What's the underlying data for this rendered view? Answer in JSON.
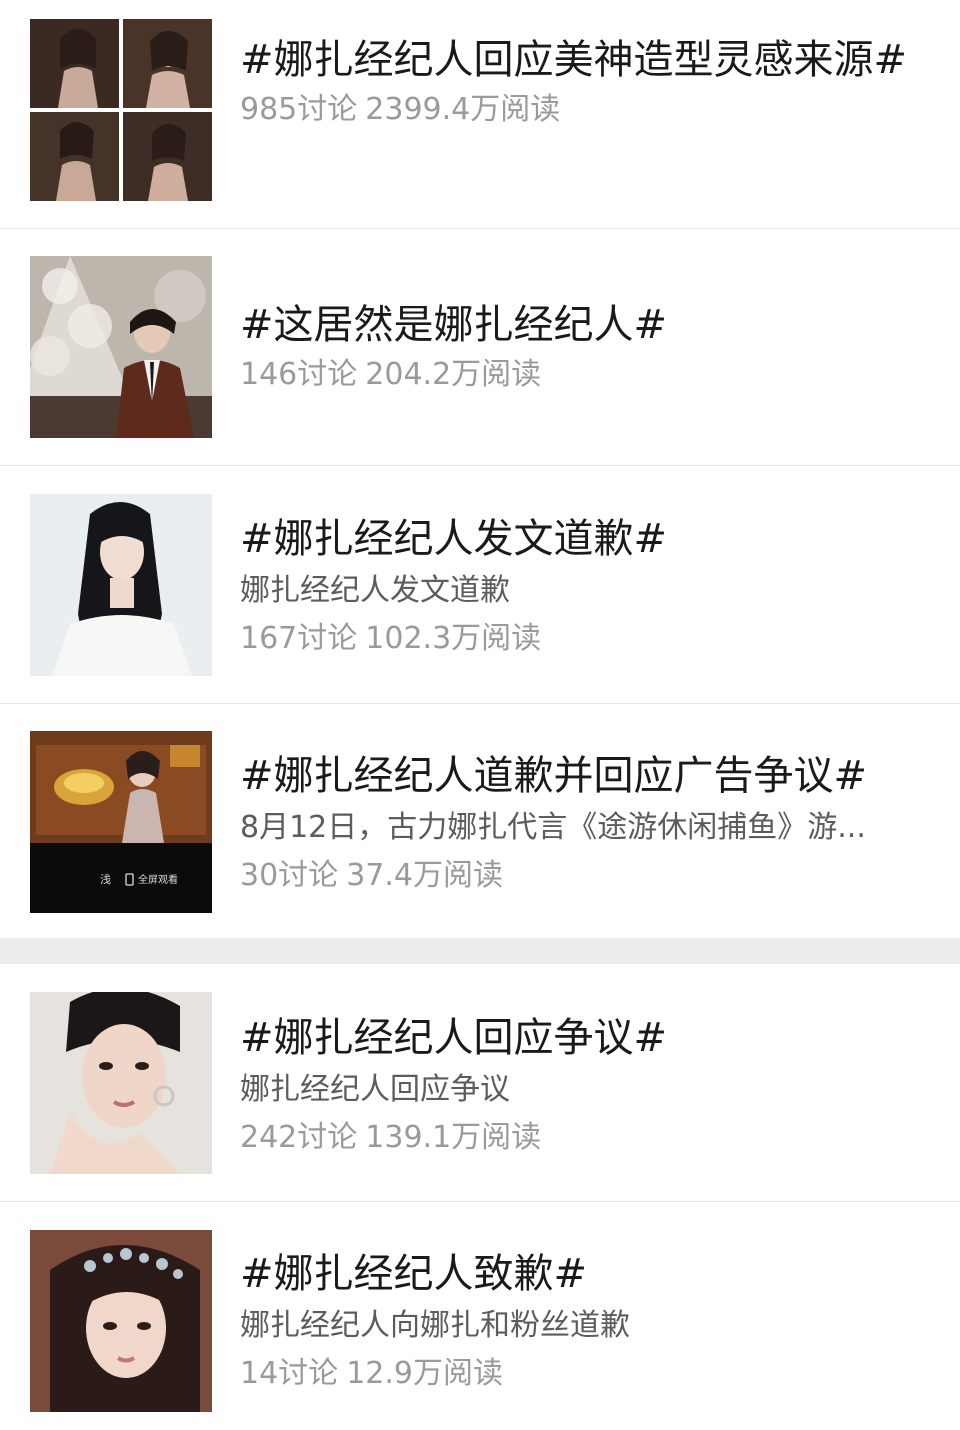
{
  "topics": [
    {
      "title": "#娜扎经纪人回应美神造型灵感来源#",
      "desc": "",
      "discussions": "985讨论",
      "reads": "2399.4万阅读",
      "thumb": "four-photo-grid-gown"
    },
    {
      "title": "#这居然是娜扎经纪人#",
      "desc": "",
      "discussions": "146讨论",
      "reads": "204.2万阅读",
      "thumb": "man-christmas-tree"
    },
    {
      "title": "#娜扎经纪人发文道歉#",
      "desc": "娜扎经纪人发文道歉",
      "discussions": "167讨论",
      "reads": "102.3万阅读",
      "thumb": "woman-white-dress"
    },
    {
      "title": "#娜扎经纪人道歉并回应广告争议#",
      "desc": "8月12日，古力娜扎代言《途游休闲捕鱼》游...",
      "discussions": "30讨论",
      "reads": "37.4万阅读",
      "thumb": "game-ad-screen",
      "thumb_labels": [
        "浅",
        "全屏观看"
      ]
    },
    {
      "title": "#娜扎经纪人回应争议#",
      "desc": "娜扎经纪人回应争议",
      "discussions": "242讨论",
      "reads": "139.1万阅读",
      "thumb": "woman-portrait-hand"
    },
    {
      "title": "#娜扎经纪人致歉#",
      "desc": "娜扎经纪人向娜扎和粉丝道歉",
      "discussions": "14讨论",
      "reads": "12.9万阅读",
      "thumb": "woman-headpiece"
    }
  ],
  "colors": {
    "title": "#1a1a1a",
    "desc": "#5c5c5c",
    "stats": "#9a9a9a",
    "divider": "#e6e6e6",
    "section_gap": "#ededed"
  }
}
